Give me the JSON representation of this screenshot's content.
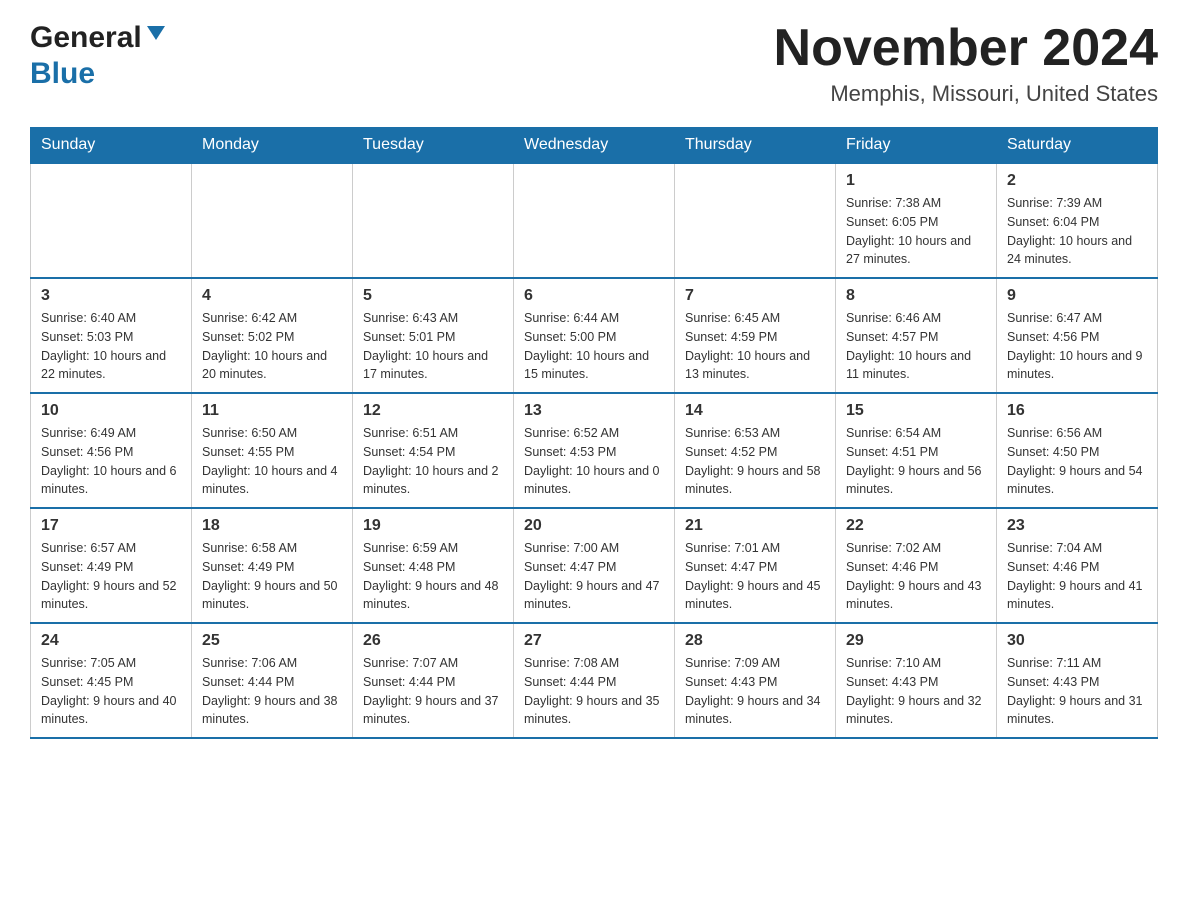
{
  "header": {
    "logo_general": "General",
    "logo_blue": "Blue",
    "month_title": "November 2024",
    "location": "Memphis, Missouri, United States"
  },
  "days_of_week": [
    "Sunday",
    "Monday",
    "Tuesday",
    "Wednesday",
    "Thursday",
    "Friday",
    "Saturday"
  ],
  "weeks": [
    [
      {
        "day": "",
        "info": ""
      },
      {
        "day": "",
        "info": ""
      },
      {
        "day": "",
        "info": ""
      },
      {
        "day": "",
        "info": ""
      },
      {
        "day": "",
        "info": ""
      },
      {
        "day": "1",
        "info": "Sunrise: 7:38 AM\nSunset: 6:05 PM\nDaylight: 10 hours and 27 minutes."
      },
      {
        "day": "2",
        "info": "Sunrise: 7:39 AM\nSunset: 6:04 PM\nDaylight: 10 hours and 24 minutes."
      }
    ],
    [
      {
        "day": "3",
        "info": "Sunrise: 6:40 AM\nSunset: 5:03 PM\nDaylight: 10 hours and 22 minutes."
      },
      {
        "day": "4",
        "info": "Sunrise: 6:42 AM\nSunset: 5:02 PM\nDaylight: 10 hours and 20 minutes."
      },
      {
        "day": "5",
        "info": "Sunrise: 6:43 AM\nSunset: 5:01 PM\nDaylight: 10 hours and 17 minutes."
      },
      {
        "day": "6",
        "info": "Sunrise: 6:44 AM\nSunset: 5:00 PM\nDaylight: 10 hours and 15 minutes."
      },
      {
        "day": "7",
        "info": "Sunrise: 6:45 AM\nSunset: 4:59 PM\nDaylight: 10 hours and 13 minutes."
      },
      {
        "day": "8",
        "info": "Sunrise: 6:46 AM\nSunset: 4:57 PM\nDaylight: 10 hours and 11 minutes."
      },
      {
        "day": "9",
        "info": "Sunrise: 6:47 AM\nSunset: 4:56 PM\nDaylight: 10 hours and 9 minutes."
      }
    ],
    [
      {
        "day": "10",
        "info": "Sunrise: 6:49 AM\nSunset: 4:56 PM\nDaylight: 10 hours and 6 minutes."
      },
      {
        "day": "11",
        "info": "Sunrise: 6:50 AM\nSunset: 4:55 PM\nDaylight: 10 hours and 4 minutes."
      },
      {
        "day": "12",
        "info": "Sunrise: 6:51 AM\nSunset: 4:54 PM\nDaylight: 10 hours and 2 minutes."
      },
      {
        "day": "13",
        "info": "Sunrise: 6:52 AM\nSunset: 4:53 PM\nDaylight: 10 hours and 0 minutes."
      },
      {
        "day": "14",
        "info": "Sunrise: 6:53 AM\nSunset: 4:52 PM\nDaylight: 9 hours and 58 minutes."
      },
      {
        "day": "15",
        "info": "Sunrise: 6:54 AM\nSunset: 4:51 PM\nDaylight: 9 hours and 56 minutes."
      },
      {
        "day": "16",
        "info": "Sunrise: 6:56 AM\nSunset: 4:50 PM\nDaylight: 9 hours and 54 minutes."
      }
    ],
    [
      {
        "day": "17",
        "info": "Sunrise: 6:57 AM\nSunset: 4:49 PM\nDaylight: 9 hours and 52 minutes."
      },
      {
        "day": "18",
        "info": "Sunrise: 6:58 AM\nSunset: 4:49 PM\nDaylight: 9 hours and 50 minutes."
      },
      {
        "day": "19",
        "info": "Sunrise: 6:59 AM\nSunset: 4:48 PM\nDaylight: 9 hours and 48 minutes."
      },
      {
        "day": "20",
        "info": "Sunrise: 7:00 AM\nSunset: 4:47 PM\nDaylight: 9 hours and 47 minutes."
      },
      {
        "day": "21",
        "info": "Sunrise: 7:01 AM\nSunset: 4:47 PM\nDaylight: 9 hours and 45 minutes."
      },
      {
        "day": "22",
        "info": "Sunrise: 7:02 AM\nSunset: 4:46 PM\nDaylight: 9 hours and 43 minutes."
      },
      {
        "day": "23",
        "info": "Sunrise: 7:04 AM\nSunset: 4:46 PM\nDaylight: 9 hours and 41 minutes."
      }
    ],
    [
      {
        "day": "24",
        "info": "Sunrise: 7:05 AM\nSunset: 4:45 PM\nDaylight: 9 hours and 40 minutes."
      },
      {
        "day": "25",
        "info": "Sunrise: 7:06 AM\nSunset: 4:44 PM\nDaylight: 9 hours and 38 minutes."
      },
      {
        "day": "26",
        "info": "Sunrise: 7:07 AM\nSunset: 4:44 PM\nDaylight: 9 hours and 37 minutes."
      },
      {
        "day": "27",
        "info": "Sunrise: 7:08 AM\nSunset: 4:44 PM\nDaylight: 9 hours and 35 minutes."
      },
      {
        "day": "28",
        "info": "Sunrise: 7:09 AM\nSunset: 4:43 PM\nDaylight: 9 hours and 34 minutes."
      },
      {
        "day": "29",
        "info": "Sunrise: 7:10 AM\nSunset: 4:43 PM\nDaylight: 9 hours and 32 minutes."
      },
      {
        "day": "30",
        "info": "Sunrise: 7:11 AM\nSunset: 4:43 PM\nDaylight: 9 hours and 31 minutes."
      }
    ]
  ],
  "colors": {
    "header_bg": "#1a6fa8",
    "header_text": "#ffffff",
    "border": "#999999",
    "blue_accent": "#1a6fa8"
  }
}
